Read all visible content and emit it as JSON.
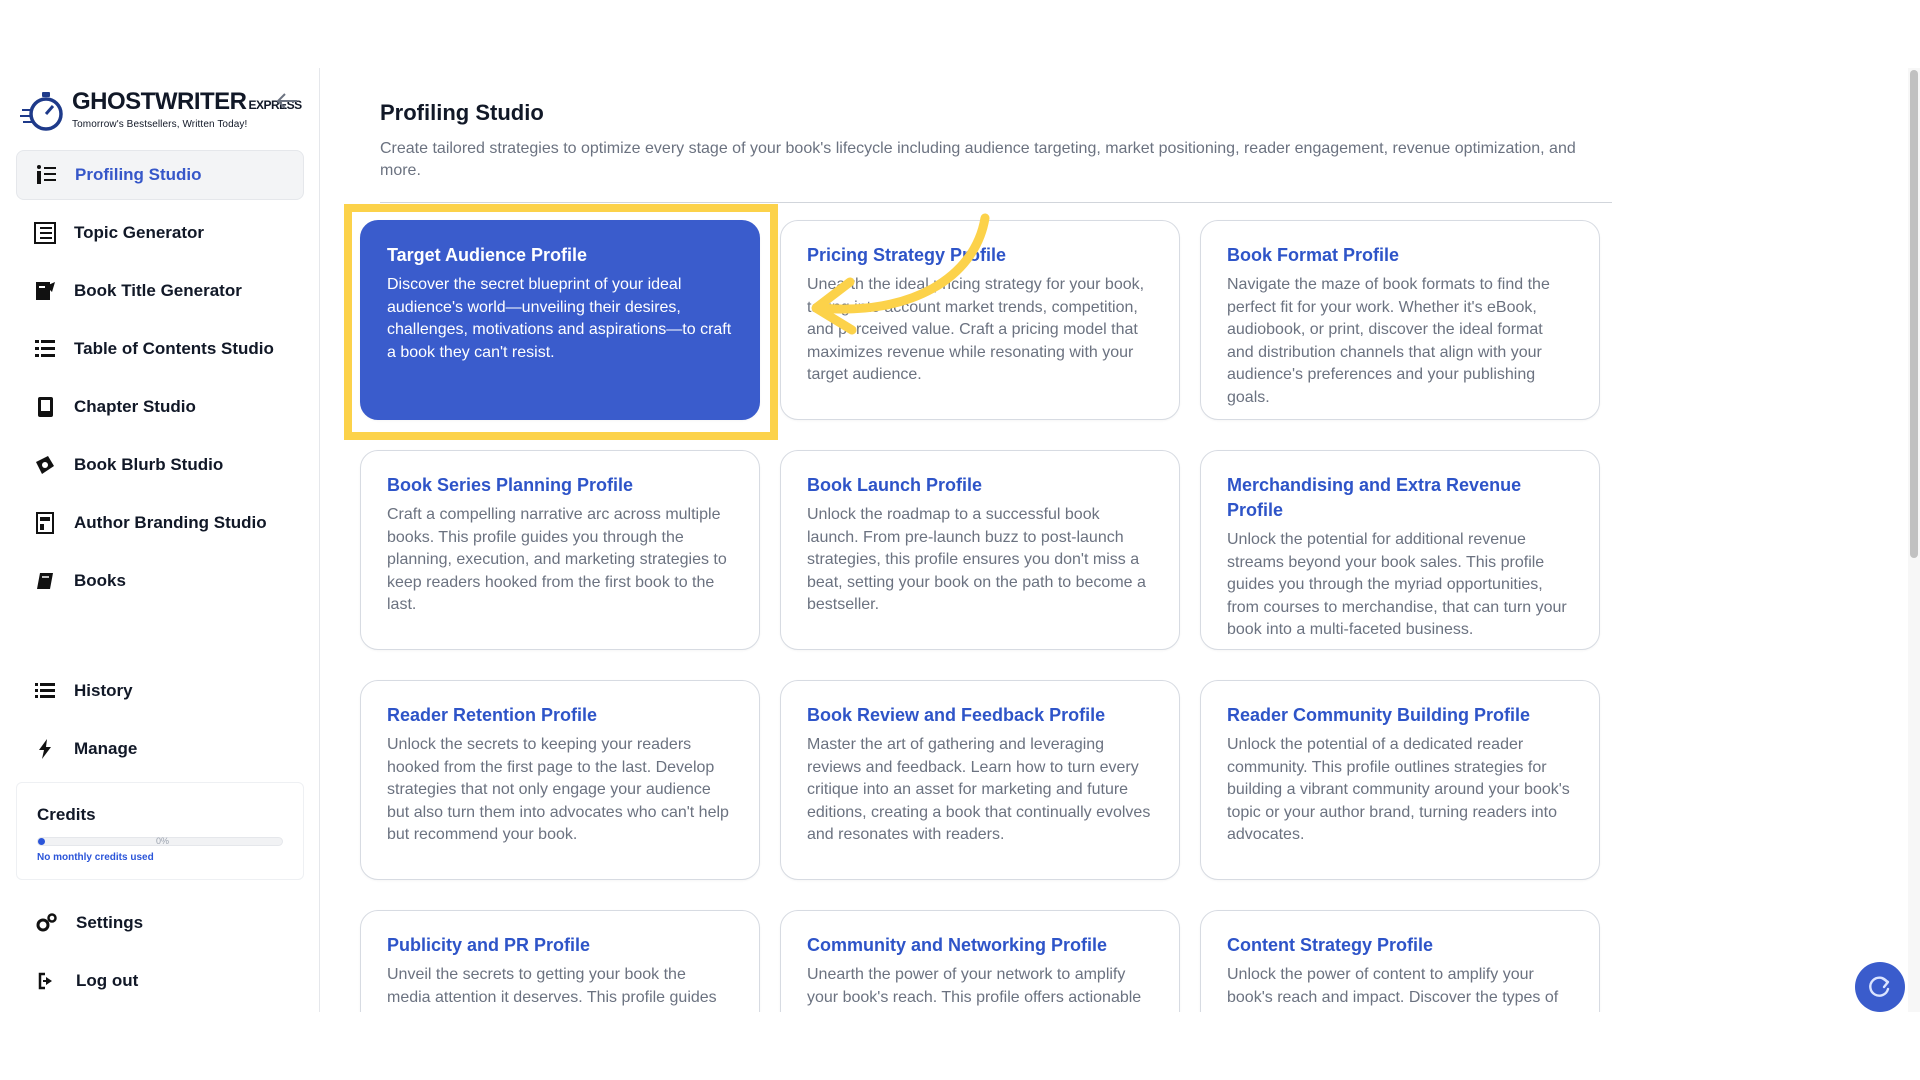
{
  "brand": {
    "name": "GHOSTWRITER",
    "suffix": "EXPRESS",
    "tagline": "Tomorrow's Bestsellers, Written Today!"
  },
  "sidebar": {
    "items": [
      {
        "label": "Profiling Studio",
        "icon": "list-icon",
        "active": true
      },
      {
        "label": "Topic Generator",
        "icon": "topic-icon"
      },
      {
        "label": "Book Title Generator",
        "icon": "book-title-icon"
      },
      {
        "label": "Table of Contents Studio",
        "icon": "toc-icon"
      },
      {
        "label": "Chapter Studio",
        "icon": "chapter-icon"
      },
      {
        "label": "Book Blurb Studio",
        "icon": "blurb-icon"
      },
      {
        "label": "Author Branding Studio",
        "icon": "branding-icon"
      },
      {
        "label": "Books",
        "icon": "book-icon"
      }
    ],
    "secondary": [
      {
        "label": "History",
        "icon": "history-icon"
      },
      {
        "label": "Manage",
        "icon": "bolt-icon"
      }
    ],
    "credits": {
      "title": "Credits",
      "percent_label": "0%",
      "progress": 0.03,
      "note": "No monthly credits used"
    },
    "footer": [
      {
        "label": "Settings",
        "icon": "gear-icon"
      },
      {
        "label": "Log out",
        "icon": "logout-icon"
      }
    ]
  },
  "main": {
    "title": "Profiling Studio",
    "description": "Create tailored strategies to optimize every stage of your book's lifecycle including audience targeting, market positioning, reader engagement, revenue optimization, and more.",
    "cards": [
      {
        "title": "Target Audience Profile",
        "desc": "Discover the secret blueprint of your ideal audience's world—unveiling their desires, challenges, motivations and aspirations—to craft a book they can't resist.",
        "selected": true
      },
      {
        "title": "Pricing Strategy Profile",
        "desc": "Unearth the ideal pricing strategy for your book, taking into account market trends, competition, and perceived value. Craft a pricing model that maximizes revenue while resonating with your target audience."
      },
      {
        "title": "Book Format Profile",
        "desc": "Navigate the maze of book formats to find the perfect fit for your work. Whether it's eBook, audiobook, or print, discover the ideal format and distribution channels that align with your audience's preferences and your publishing goals."
      },
      {
        "title": "Book Series Planning Profile",
        "desc": "Craft a compelling narrative arc across multiple books. This profile guides you through the planning, execution, and marketing strategies to keep readers hooked from the first book to the last."
      },
      {
        "title": "Book Launch Profile",
        "desc": "Unlock the roadmap to a successful book launch. From pre-launch buzz to post-launch strategies, this profile ensures you don't miss a beat, setting your book on the path to become a bestseller."
      },
      {
        "title": "Merchandising and Extra Revenue Profile",
        "desc": "Unlock the potential for additional revenue streams beyond your book sales. This profile guides you through the myriad opportunities, from courses to merchandise, that can turn your book into a multi-faceted business."
      },
      {
        "title": "Reader Retention Profile",
        "desc": "Unlock the secrets to keeping your readers hooked from the first page to the last. Develop strategies that not only engage your audience but also turn them into advocates who can't help but recommend your book."
      },
      {
        "title": "Book Review and Feedback Profile",
        "desc": "Master the art of gathering and leveraging reviews and feedback. Learn how to turn every critique into an asset for marketing and future editions, creating a book that continually evolves and resonates with readers."
      },
      {
        "title": "Reader Community Building Profile",
        "desc": "Unlock the potential of a dedicated reader community. This profile outlines strategies for building a vibrant community around your book's topic or your author brand, turning readers into advocates."
      },
      {
        "title": "Publicity and PR Profile",
        "desc": "Unveil the secrets to getting your book the media attention it deserves. This profile guides you through the"
      },
      {
        "title": "Community and Networking Profile",
        "desc": "Unearth the power of your network to amplify your book's reach. This profile offers actionable"
      },
      {
        "title": "Content Strategy Profile",
        "desc": "Unlock the power of content to amplify your book's reach and impact. Discover the types of content that connect with"
      }
    ]
  },
  "colors": {
    "accent": "#3a5ccc",
    "link": "#2e54c8",
    "highlight": "#fcd24a"
  }
}
